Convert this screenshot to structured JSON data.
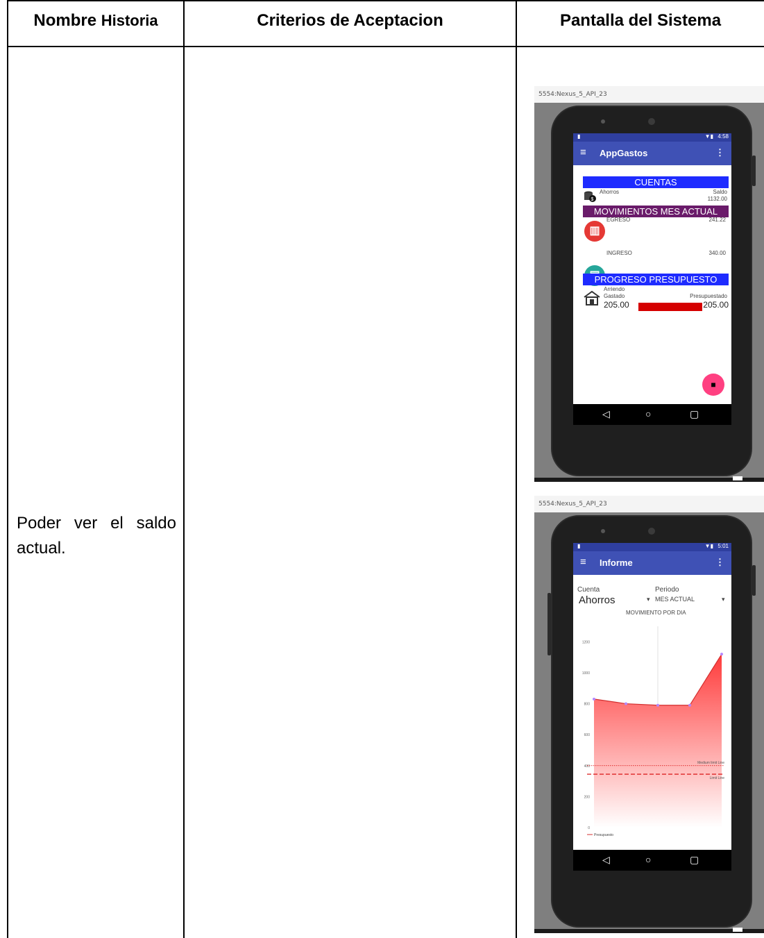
{
  "table": {
    "headers": {
      "col1_bold": "Nombre",
      "col1_rest": "Historia",
      "col2": "Criterios de Aceptacion",
      "col3": "Pantalla del Sistema"
    },
    "row": {
      "story": "Poder ver el saldo actual.",
      "criteria": ""
    }
  },
  "screenshots": {
    "emulator_title": "5554:Nexus_5_API_23",
    "first": {
      "status_time": "4:58",
      "app_title": "AppGastos",
      "sections": {
        "cuentas": "CUENTAS",
        "movimientos": "MOVIMIENTOS MES ACTUAL",
        "progreso": "PROGRESO PRESUPUESTO"
      },
      "cuenta": {
        "name": "Ahorros",
        "saldo_label": "Saldo",
        "saldo_value": "1132.00"
      },
      "egreso": {
        "label": "EGRESO",
        "value": "241.22"
      },
      "ingreso": {
        "label": "INGRESO",
        "value": "340.00"
      },
      "presupuesto": {
        "name": "Arriendo",
        "gastado_label": "Gastado",
        "presupuestado_label": "Presupuestado",
        "gastado_value": "205.00",
        "presupuestado_value": "205.00",
        "progress_fraction": 1.0
      },
      "colors": {
        "cuentas": "#1e2bff",
        "movimientos": "#6a1b6a",
        "progreso": "#1e2bff",
        "egreso": "#e53935",
        "ingreso": "#26a69a",
        "bar": "#d50000",
        "fab": "#ff4081"
      }
    },
    "second": {
      "status_time": "5:01",
      "app_title": "Informe",
      "cuenta_label": "Cuenta",
      "cuenta_value": "Ahorros",
      "periodo_label": "Periodo",
      "periodo_value": "MES ACTUAL",
      "chart_title": "MOVIMIENTO POR DIA",
      "legend": "Presupuesto",
      "limit_labels": [
        "Medium limit Line",
        "Limit Line"
      ]
    },
    "nav": {
      "back": "◁",
      "home": "○",
      "recent": "▢"
    }
  },
  "chart_data": {
    "type": "area",
    "title": "MOVIMIENTO POR DIA",
    "x": [
      1,
      2,
      3,
      4,
      5
    ],
    "series": [
      {
        "name": "Presupuesto",
        "values": [
          830,
          800,
          790,
          790,
          1120
        ]
      }
    ],
    "ylim": [
      0,
      1300
    ],
    "yticks": [
      0,
      200,
      400,
      600,
      800,
      1000,
      1200
    ],
    "limit_lines": [
      {
        "label": "Medium limit Line",
        "value": 400
      },
      {
        "label": "Limit Line",
        "value": 345
      }
    ]
  }
}
